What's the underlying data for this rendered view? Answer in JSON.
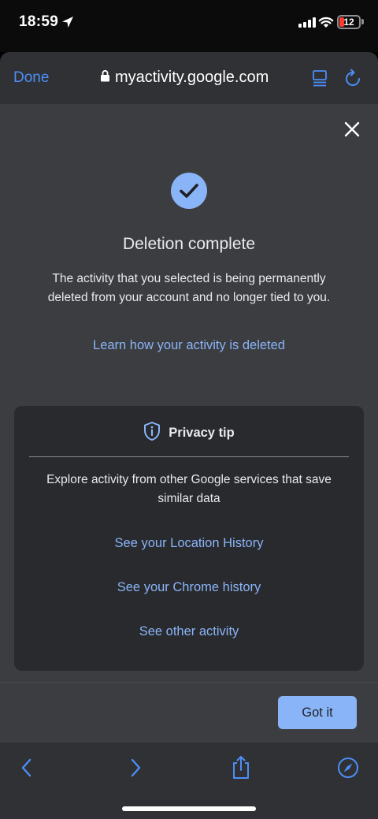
{
  "status_bar": {
    "time": "18:59",
    "battery_level": "12",
    "icons": [
      "location-arrow-icon",
      "signal-icon",
      "wifi-icon",
      "battery-icon"
    ]
  },
  "browser": {
    "done_label": "Done",
    "url": "myactivity.google.com",
    "icons": [
      "lock-icon",
      "reader-icon",
      "reload-icon"
    ]
  },
  "dialog": {
    "title": "Deletion complete",
    "description": "The activity that you selected is being permanently deleted from your account and no longer tied to you.",
    "learn_link": "Learn how your activity is deleted",
    "privacy_tip": {
      "title": "Privacy tip",
      "text": "Explore activity from other Google services that save similar data",
      "links": [
        "See your Location History",
        "See your Chrome history",
        "See other activity"
      ]
    },
    "got_it_label": "Got it"
  },
  "colors": {
    "accent": "#8ab4f8",
    "ios_link": "#4c8ef7",
    "page_bg": "#3c3d40",
    "card_bg": "#292a2d",
    "toolbar_bg": "#303134"
  }
}
